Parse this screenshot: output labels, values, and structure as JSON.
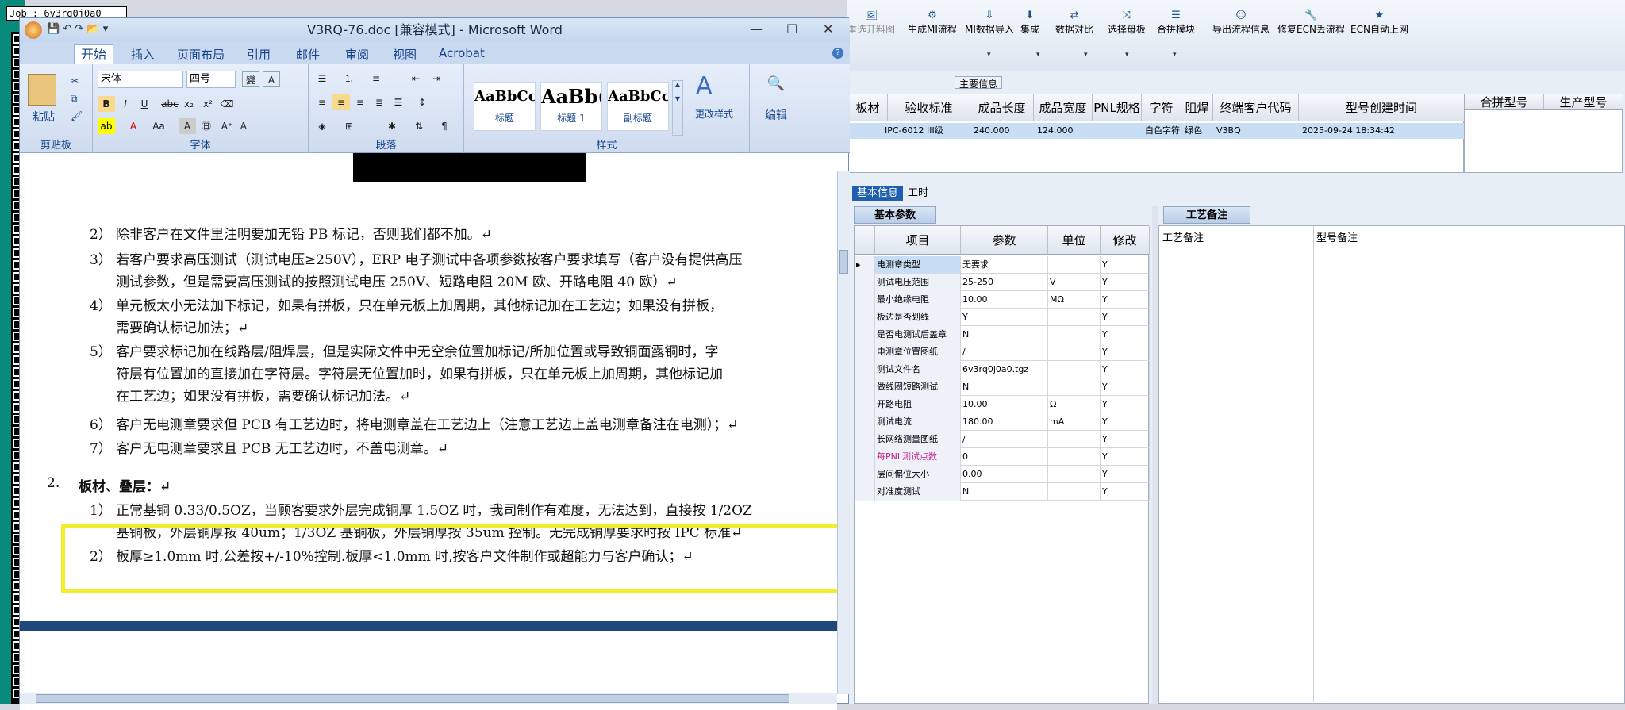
{
  "job": "Job : 6v3rq0j0a0",
  "right_toolbar": [
    {
      "label": "重选开料图",
      "icon": "image-icon"
    },
    {
      "label": "生成MI流程",
      "icon": "gears-icon"
    },
    {
      "label": "MI数据导入",
      "icon": "import-icon"
    },
    {
      "label": "集成",
      "icon": "download-icon"
    },
    {
      "label": "数据对比",
      "icon": "compare-icon"
    },
    {
      "label": "选择母板",
      "icon": "shuffle-icon"
    },
    {
      "label": "合拼模块",
      "icon": "list-icon"
    },
    {
      "label": "导出流程信息",
      "icon": "smile-icon"
    },
    {
      "label": "修复ECN丢流程",
      "icon": "wrench-icon"
    },
    {
      "label": "ECN自动上网",
      "icon": "star-icon"
    }
  ],
  "main_info_label": "主要信息",
  "top_table": {
    "headers": [
      "板材",
      "验收标准",
      "成品长度",
      "成品宽度",
      "PNL规格",
      "字符",
      "阻焊",
      "终端客户代码",
      "型号创建时间"
    ],
    "row": [
      "",
      "IPC-6012 III级",
      "240.000",
      "124.000",
      "",
      "白色字符",
      "绿色",
      "V3BQ",
      "2025-09-24 18:34:42"
    ],
    "side_headers": [
      "合拼型号",
      "生产型号"
    ]
  },
  "tabs": [
    "基本信息",
    "工时"
  ],
  "sub_tabs": [
    "基本参数",
    "工艺备注"
  ],
  "param_headers": [
    "项目",
    "参数",
    "单位",
    "修改"
  ],
  "params": [
    [
      "电测章类型",
      "无要求",
      "",
      "Y"
    ],
    [
      "测试电压范围",
      "25-250",
      "V",
      "Y"
    ],
    [
      "最小绝缘电阻",
      "10.00",
      "MΩ",
      "Y"
    ],
    [
      "板边是否划线",
      "Y",
      "",
      "Y"
    ],
    [
      "是否电测试后盖章",
      "N",
      "",
      "Y"
    ],
    [
      "电测章位置图纸",
      "/",
      "",
      "Y"
    ],
    [
      "测试文件名",
      "6v3rq0j0a0.tgz",
      "",
      "Y"
    ],
    [
      "做线圈短路测试",
      "N",
      "",
      "Y"
    ],
    [
      "开路电阻",
      "10.00",
      "Ω",
      "Y"
    ],
    [
      "测试电流",
      "180.00",
      "mA",
      "Y"
    ],
    [
      "长网络测量图纸",
      "/",
      "",
      "Y"
    ],
    [
      "每PNL测试点数",
      "0",
      "",
      "Y"
    ],
    [
      "层间偏位大小",
      "0.00",
      "",
      "Y"
    ],
    [
      "对准度测试",
      "N",
      "",
      "Y"
    ]
  ],
  "notes_headers": [
    "工艺备注",
    "型号备注"
  ],
  "word": {
    "title": "V3RQ-76.doc [兼容模式] - Microsoft Word",
    "tabs": [
      "开始",
      "插入",
      "页面布局",
      "引用",
      "邮件",
      "审阅",
      "视图",
      "Acrobat"
    ],
    "groups": {
      "clipboard": "剪贴板",
      "font": "字体",
      "paragraph": "段落",
      "styles": "样式"
    },
    "paste": "粘贴",
    "font_name": "宋体",
    "font_size": "四号",
    "styles": [
      {
        "preview": "AaBbCc",
        "name": "标题"
      },
      {
        "preview": "AaBb(",
        "name": "标题 1"
      },
      {
        "preview": "AaBbCc",
        "name": "副标题"
      }
    ],
    "change_styles": "更改样式",
    "edit": "编辑",
    "lines": [
      {
        "n": "2）",
        "t": "除非客户在文件里注明要加无铅 PB 标记，否则我们都不加。↵"
      },
      {
        "n": "3）",
        "t": "若客户要求高压测试（测试电压≥250V），ERP 电子测试中各项参数按客户要求填写（客户没有提供高压"
      },
      {
        "n": "",
        "t": "测试参数，但是需要高压测试的按照测试电压 250V、短路电阻 20M 欧、开路电阻 40 欧）↵"
      },
      {
        "n": "4）",
        "t": "单元板太小无法加下标记，如果有拼板，只在单元板上加周期，其他标记加在工艺边；如果没有拼板，"
      },
      {
        "n": "",
        "t": "需要确认标记加法；↵"
      },
      {
        "n": "5）",
        "t": "客户要求标记加在线路层/阻焊层，但是实际文件中无空余位置加标记/所加位置或导致铜面露铜时，字"
      },
      {
        "n": "",
        "t": "符层有位置加的直接加在字符层。字符层无位置加时，如果有拼板，只在单元板上加周期，其他标记加"
      },
      {
        "n": "",
        "t": "在工艺边；如果没有拼板，需要确认标记加法。↵"
      },
      {
        "n": "6）",
        "t": "客户无电测章要求但 PCB 有工艺边时，将电测章盖在工艺边上（注意工艺边上盖电测章备注在电测）；↵"
      },
      {
        "n": "7）",
        "t": "客户无电测章要求且 PCB 无工艺边时，不盖电测章。↵"
      },
      {
        "n": "2.",
        "t": "板材、叠层：↵"
      },
      {
        "n": "1）",
        "t": "正常基铜 0.33/0.5OZ，当顾客要求外层完成铜厚 1.5OZ 时，我司制作有难度，无法达到，直接按 1/2OZ"
      },
      {
        "n": "",
        "t": "基铜板，外层铜厚按 40um；1/3OZ 基铜板，外层铜厚按 35um 控制。无完成铜厚要求时按 IPC 标准↵"
      },
      {
        "n": "2）",
        "t": "板厚≥1.0mm 时,公差按+/-10%控制.板厚<1.0mm 时,按客户文件制作或超能力与客户确认；↵"
      }
    ]
  }
}
